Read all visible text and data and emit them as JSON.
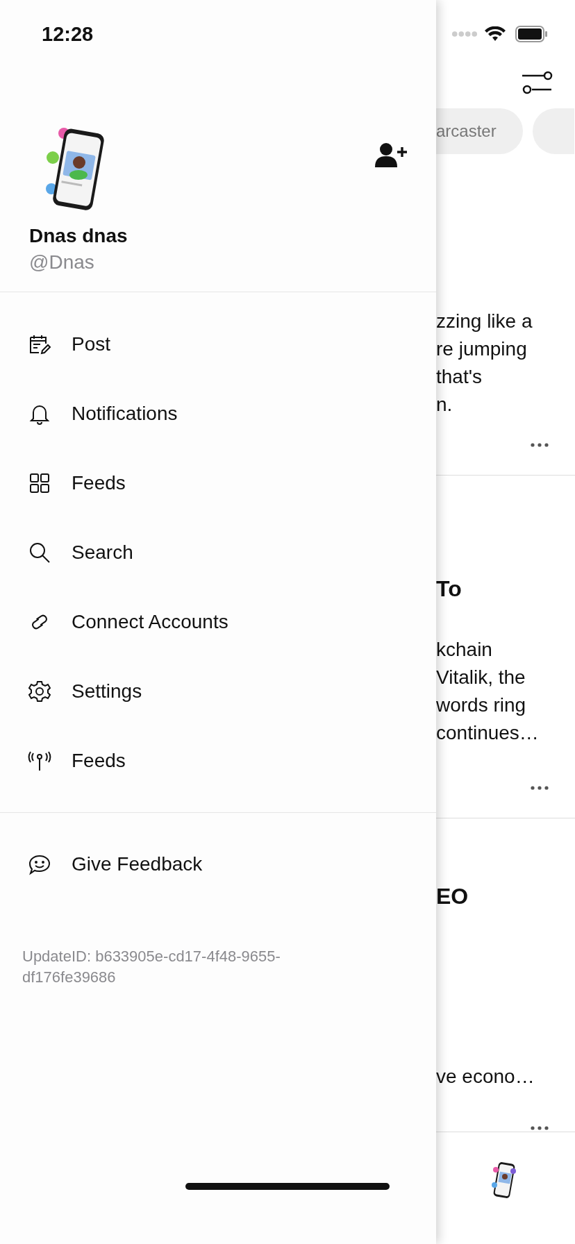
{
  "status_bar": {
    "time": "12:28"
  },
  "profile": {
    "name": "Dnas dnas",
    "handle": "@Dnas"
  },
  "menu": [
    {
      "label": "Post",
      "kind": "post"
    },
    {
      "label": "Notifications",
      "kind": "bell"
    },
    {
      "label": "Feeds",
      "kind": "grid"
    },
    {
      "label": "Search",
      "kind": "search"
    },
    {
      "label": "Connect Accounts",
      "kind": "link"
    },
    {
      "label": "Settings",
      "kind": "gear"
    },
    {
      "label": "Feeds",
      "kind": "antenna"
    }
  ],
  "footer_menu": [
    {
      "label": "Give Feedback",
      "kind": "feedback"
    }
  ],
  "update_id": "UpdateID: b633905e-cd17-4f48-9655-df176fe39686",
  "background": {
    "filter_chips": [
      {
        "label": "arcaster"
      },
      {
        "kind": "chip"
      }
    ],
    "posts": [
      {
        "lines": [
          "zzing like a",
          "re jumping",
          "that's",
          "n."
        ]
      },
      {
        "title": "To",
        "lines": [
          "kchain",
          "Vitalik, the",
          "words ring",
          "continues…"
        ]
      },
      {
        "title": "EO",
        "lines": [
          "ve econo…"
        ]
      }
    ]
  }
}
